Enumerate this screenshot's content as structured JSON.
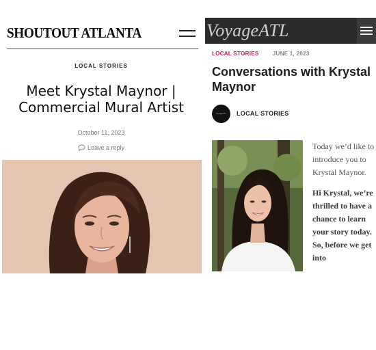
{
  "shoutout": {
    "logo": "SHOUTOUT ATLANTA",
    "category": "LOCAL STORIES",
    "title": "Meet Krystal Maynor | Commercial Mural Artist",
    "date": "October 11, 2023",
    "reply": "Leave a reply",
    "icons": {
      "menu": "hamburger-menu-icon",
      "reply": "speech-bubble-icon"
    },
    "colors": {
      "photo_bg": "#e3c5b2",
      "rule": "#444444"
    }
  },
  "voyage": {
    "logo": "VoyageATL",
    "category": "LOCAL STORIES",
    "date": "JUNE 1, 2023",
    "title": "Conversations with Krystal Maynor",
    "badge_text": "VoyageATL",
    "badge_label": "LOCAL STORIES",
    "intro": "Today we’d like to introduce you to Krystal Maynor.",
    "question": "Hi Krystal, we’re thrilled to have a chance to learn your story today. So, before we get into",
    "icons": {
      "menu": "hamburger-menu-icon"
    },
    "colors": {
      "topbar": "#2b2b2b",
      "category": "#c2185b",
      "logo": "#d0d0d0"
    }
  }
}
